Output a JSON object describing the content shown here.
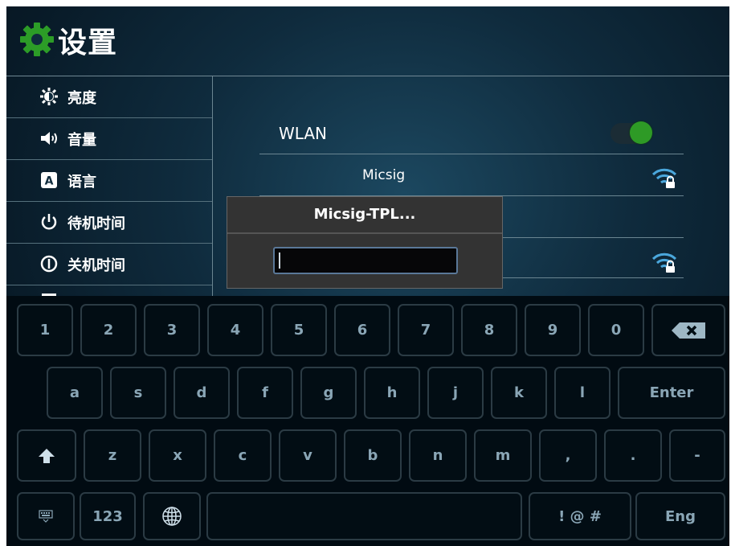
{
  "header": {
    "title": "设置"
  },
  "sidebar": {
    "items": [
      {
        "label": "亮度",
        "icon": "brightness-icon"
      },
      {
        "label": "音量",
        "icon": "volume-icon"
      },
      {
        "label": "语言",
        "icon": "language-icon"
      },
      {
        "label": "待机时间",
        "icon": "power-icon"
      },
      {
        "label": "关机时间",
        "icon": "shutdown-icon"
      }
    ]
  },
  "wlan": {
    "label": "WLAN",
    "enabled": true,
    "networks": [
      {
        "name": "Micsig",
        "secured": true
      },
      {
        "name": "",
        "secured": true
      }
    ]
  },
  "dialog": {
    "title": "Micsig-TPL...",
    "password": ""
  },
  "keyboard": {
    "row1": [
      "1",
      "2",
      "3",
      "4",
      "5",
      "6",
      "7",
      "8",
      "9",
      "0"
    ],
    "row2": [
      "a",
      "s",
      "d",
      "f",
      "g",
      "h",
      "j",
      "k",
      "l"
    ],
    "enter": "Enter",
    "row3": [
      "z",
      "x",
      "c",
      "v",
      "b",
      "n",
      "m",
      ",",
      ".",
      "-"
    ],
    "numeric": "123",
    "symbols": "! @ #",
    "lang": "Eng"
  },
  "colors": {
    "accent_green": "#2e9a26",
    "background": "#0f2b3d"
  }
}
